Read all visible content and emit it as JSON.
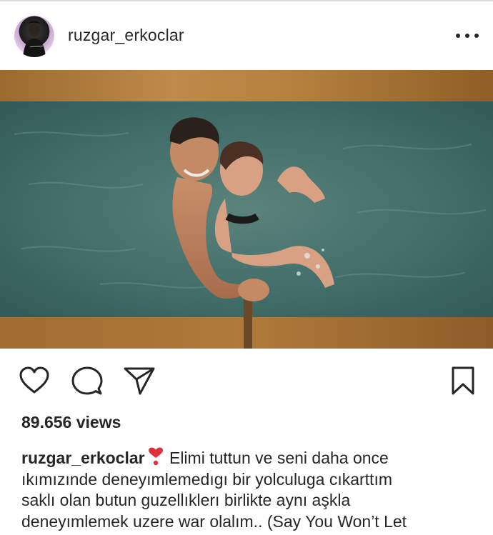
{
  "post": {
    "username": "ruzgar_erkoclar",
    "views_label": "89.656 views",
    "caption": {
      "username": "ruzgar_erkoclar",
      "emoji": "heavy-heart-exclamation",
      "line1": " Elimi tuttun ve seni daha once",
      "line2": "ıkımızınde deneyımlemedıgı bir yolculuga cıkarttım",
      "line3": "saklı olan butun guzellıklerı birlikte aynı aşkla",
      "line4": "deneyımlemek uzere war olalım.. (Say You Won’t Let"
    }
  },
  "icons": {
    "more": "more-horizontal-icon",
    "like": "heart-outline-icon",
    "comment": "speech-bubble-icon",
    "share": "paper-plane-icon",
    "save": "bookmark-icon"
  },
  "colors": {
    "text": "#262626",
    "divider": "#dbdbdb",
    "water": "#3f6a66",
    "sand_band": "#b07a3a",
    "emoji_red": "#e0303a"
  }
}
